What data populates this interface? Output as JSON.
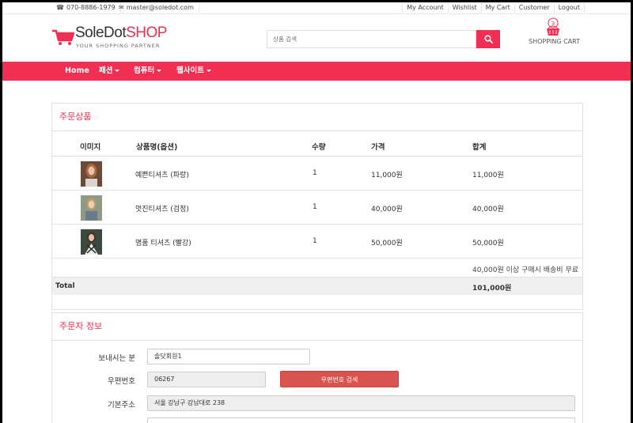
{
  "topbar": {
    "phone": "070-8886-1979",
    "email": "master@soledot.com",
    "links": [
      "My Account",
      "Wishlist",
      "My Cart",
      "Customer",
      "Logout"
    ]
  },
  "header": {
    "logo_main": "SoleDot",
    "logo_accent": "SHOP",
    "tagline": "YOUR SHOPPING PARTNER",
    "search_placeholder": "상품 검색",
    "cart_count": "3",
    "cart_label": "SHOPPING CART"
  },
  "nav": {
    "items": [
      {
        "label": "Home",
        "dropdown": false
      },
      {
        "label": "패션",
        "dropdown": true
      },
      {
        "label": "컴퓨터",
        "dropdown": true
      },
      {
        "label": "웹사이트",
        "dropdown": true
      }
    ]
  },
  "order_items": {
    "title": "주문상품",
    "columns": [
      "이미지",
      "상품명(옵션)",
      "수량",
      "가격",
      "합계"
    ],
    "rows": [
      {
        "name": "예쁜티셔츠 (파랑)",
        "qty": "1",
        "price": "11,000원",
        "total": "11,000원"
      },
      {
        "name": "멋진티셔츠 (검정)",
        "qty": "1",
        "price": "40,000원",
        "total": "40,000원"
      },
      {
        "name": "명품 티셔츠 (빨강)",
        "qty": "1",
        "price": "50,000원",
        "total": "50,000원"
      }
    ],
    "shipping_note": "40,000원 이상 구매시 배송비 무료",
    "total_label": "Total",
    "total_value": "101,000원"
  },
  "orderer": {
    "title": "주문자 정보",
    "sender_label": "보내시는 분",
    "sender_value": "솔닷회원1",
    "zip_label": "우편번호",
    "zip_value": "06267",
    "zip_button": "우편번호 검색",
    "address_label": "기본주소",
    "address_value": "서울 강남구 강남대로 238"
  },
  "colors": {
    "brand": "#f12f52",
    "accent_text": "#e8304f",
    "zip_button": "#d9534f"
  }
}
